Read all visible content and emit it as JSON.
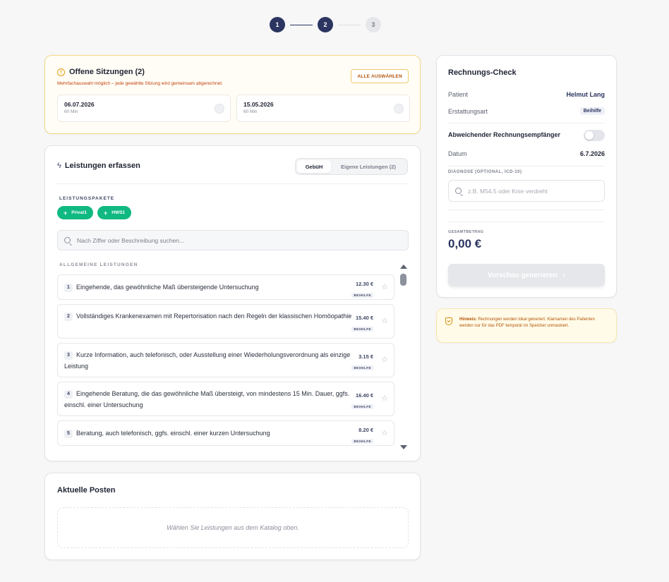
{
  "stepper": {
    "steps": [
      "1",
      "2",
      "3"
    ]
  },
  "sessions": {
    "title": "Offene Sitzungen (2)",
    "subtitle": "Mehrfachauswahl möglich – jede gewählte Sitzung wird gemeinsam abgerechnet.",
    "select_all": "ALLE AUSWÄHLEN",
    "items": [
      {
        "date": "06.07.2026",
        "duration": "60 Min"
      },
      {
        "date": "15.05.2026",
        "duration": "60 Min"
      }
    ]
  },
  "services": {
    "title": "Leistungen erfassen",
    "tabs": [
      "GebüH",
      "Eigene Leistungen (2)"
    ],
    "packages_label": "LEISTUNGSPAKETE",
    "packages": [
      "Privat1",
      "HWS1"
    ],
    "search_placeholder": "Nach Ziffer oder Beschreibung suchen...",
    "section_label": "ALLGEMEINE LEISTUNGEN",
    "items": [
      {
        "num": "1",
        "text": "Eingehende, das gewöhnliche Maß übersteigende Untersuchung",
        "price": "12.30 €",
        "badge": "BEIHILFE"
      },
      {
        "num": "2",
        "text": "Vollständiges Krankenexamen mit Repertorisation nach den Regeln der klassischen Homöopathie",
        "price": "15.40 €",
        "badge": "BEIHILFE"
      },
      {
        "num": "3",
        "text": "Kurze Information, auch telefonisch, oder Ausstellung einer Wiederholungsverordnung als einzige Leistung",
        "price": "3.15 €",
        "badge": "BEIHILFE"
      },
      {
        "num": "4",
        "text": "Eingehende Beratung, die das gewöhnliche Maß übersteigt, von mindestens 15 Min. Dauer, ggfs. einschl. einer Untersuchung",
        "price": "16.40 €",
        "badge": "BEIHILFE"
      },
      {
        "num": "5",
        "text": "Beratung, auch telefonisch, ggfs. einschl. einer kurzen Untersuchung",
        "price": "8.20 €",
        "badge": "BEIHILFE"
      }
    ]
  },
  "current": {
    "title": "Aktuelle Posten",
    "empty": "Wählen Sie Leistungen aus dem Katalog oben."
  },
  "check": {
    "title": "Rechnungs-Check",
    "patient_label": "Patient",
    "patient_value": "Helmut Lang",
    "reimb_label": "Erstattungsart",
    "reimb_value": "Beihilfe",
    "alt_recipient_label": "Abweichender Rechnungsempfänger",
    "date_label": "Datum",
    "date_value": "6.7.2026",
    "diagnosis_label": "DIAGNOSE (OPTIONAL, ICD-10)",
    "diagnosis_placeholder": "z.B. M54.5 oder Knie verdreht",
    "total_label": "GESAMTBETRAG",
    "total_value": "0,00 €",
    "preview_button": "Vorschau generieren",
    "preview_chevron": "›"
  },
  "notice": {
    "bold": "Hinweis:",
    "text": " Rechnungen werden lokal generiert. Klarnamen des Patienten werden nur für das PDF temporär im Speicher unmaskiert."
  },
  "colors": {
    "accent": "#2b3560",
    "success": "#10b981",
    "warning": "#e39b14"
  }
}
